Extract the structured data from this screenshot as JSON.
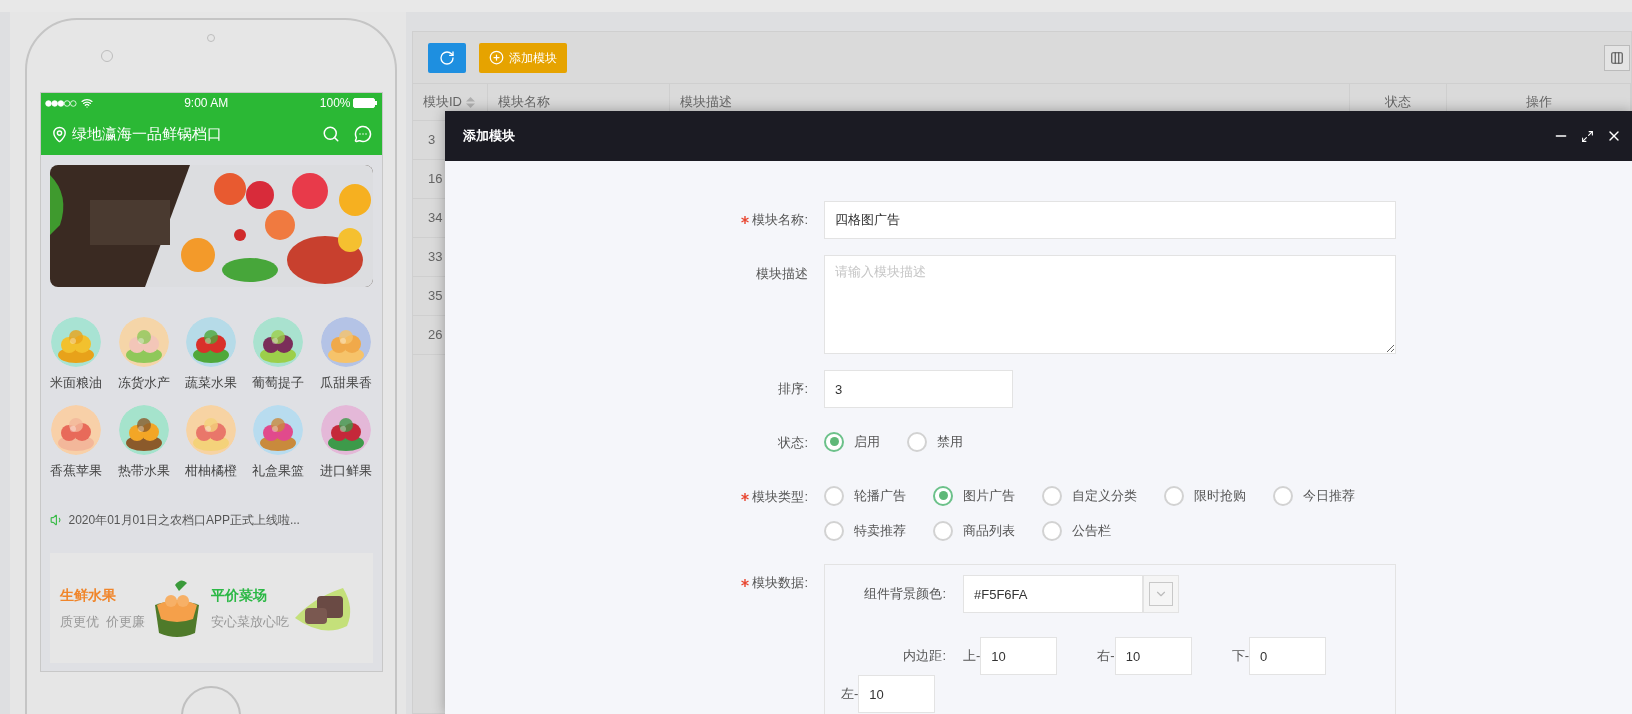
{
  "phone": {
    "status_bar": {
      "time": "9:00 AM",
      "battery": "100%"
    },
    "header": {
      "title": "绿地瀛海一品鲜锅档口"
    },
    "categories": [
      {
        "label": "米面粮油"
      },
      {
        "label": "冻货水产"
      },
      {
        "label": "蔬菜水果"
      },
      {
        "label": "葡萄提子"
      },
      {
        "label": "瓜甜果香"
      },
      {
        "label": "香蕉苹果"
      },
      {
        "label": "热带水果"
      },
      {
        "label": "柑柚橘橙"
      },
      {
        "label": "礼盒果篮"
      },
      {
        "label": "进口鲜果"
      }
    ],
    "notice": "2020年01月01日之农档口APP正式上线啦...",
    "promos": [
      {
        "title": "生鲜水果",
        "subtitle": "质更优  价更廉",
        "color": "#f0852a"
      },
      {
        "title": "平价菜场",
        "subtitle": "安心菜放心吃",
        "color": "#2bb845"
      }
    ]
  },
  "toolbar": {
    "buttons": [
      {
        "kind": "refresh"
      },
      {
        "kind": "add",
        "label": "添加模块"
      }
    ]
  },
  "table": {
    "columns": [
      {
        "label": "模块ID",
        "sortable": true
      },
      {
        "label": "模块名称",
        "sortable": false
      },
      {
        "label": "模块描述",
        "sortable": false
      },
      {
        "label": "状态",
        "sortable": false
      },
      {
        "label": "操作",
        "sortable": false
      }
    ],
    "rows": [
      {
        "id": "3"
      },
      {
        "id": "16"
      },
      {
        "id": "34"
      },
      {
        "id": "33"
      },
      {
        "id": "35"
      },
      {
        "id": "26"
      }
    ]
  },
  "dialog": {
    "title": "添加模块",
    "fields": [
      {
        "kind": "text",
        "label": "模块名称:",
        "required": true,
        "value": "四格图广告"
      },
      {
        "kind": "textarea",
        "label": "模块描述",
        "required": false,
        "placeholder": "请输入模块描述"
      },
      {
        "kind": "number",
        "label": "排序:",
        "required": false,
        "value": "3"
      },
      {
        "kind": "radio",
        "label": "状态:",
        "required": false,
        "options": [
          {
            "label": "启用",
            "selected": true
          },
          {
            "label": "禁用",
            "selected": false
          }
        ]
      },
      {
        "kind": "radio",
        "label": "模块类型:",
        "required": true,
        "options": [
          {
            "label": "轮播广告",
            "selected": false
          },
          {
            "label": "图片广告",
            "selected": true
          },
          {
            "label": "自定义分类",
            "selected": false
          },
          {
            "label": "限时抢购",
            "selected": false
          },
          {
            "label": "今日推荐",
            "selected": false
          },
          {
            "label": "特卖推荐",
            "selected": false
          },
          {
            "label": "商品列表",
            "selected": false
          },
          {
            "label": "公告栏",
            "selected": false
          }
        ]
      },
      {
        "kind": "group",
        "label": "模块数据:",
        "required": true,
        "color_field": {
          "label": "组件背景颜色:",
          "value": "#F5F6FA"
        },
        "padding": {
          "label": "内边距:",
          "sides": [
            {
              "label": "上-",
              "value": "10"
            },
            {
              "label": "右-",
              "value": "10"
            },
            {
              "label": "下-",
              "value": "0"
            },
            {
              "label": "左-",
              "value": "10"
            }
          ]
        }
      }
    ]
  }
}
